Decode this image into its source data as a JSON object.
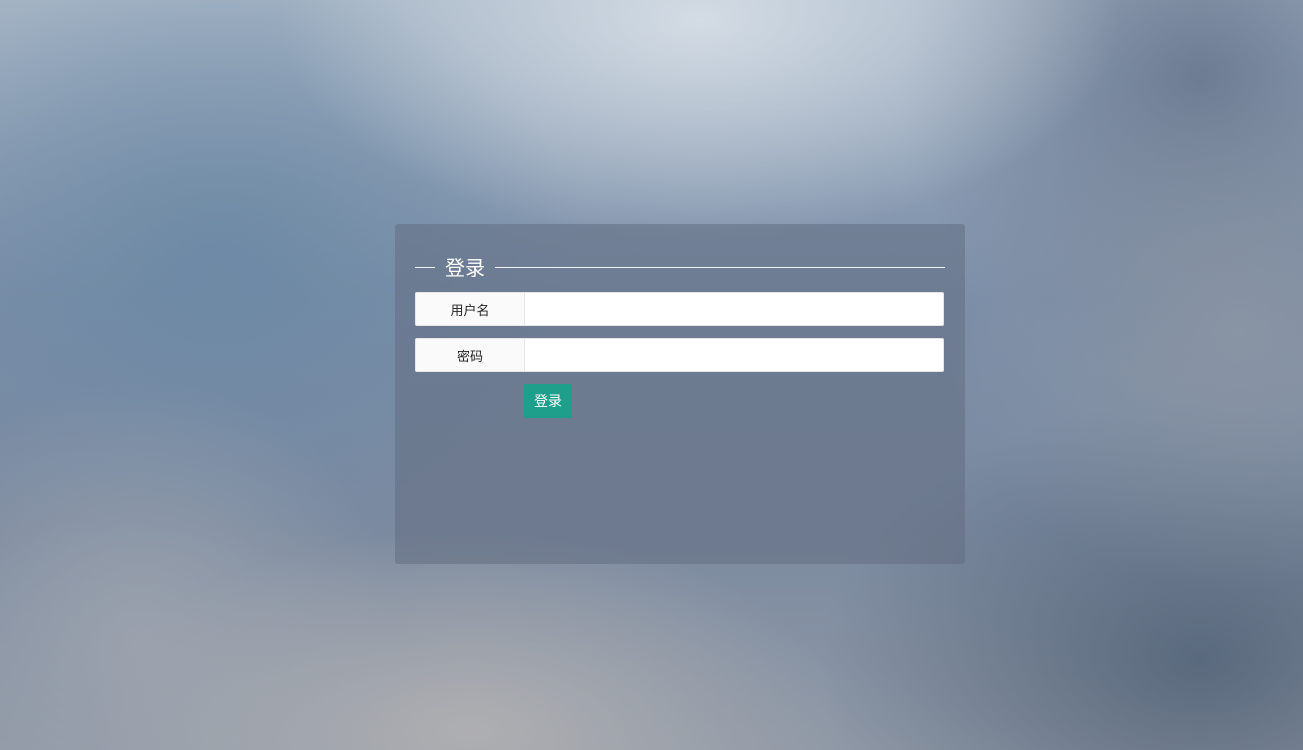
{
  "login": {
    "title": "登录",
    "username_label": "用户名",
    "username_value": "",
    "password_label": "密码",
    "password_value": "",
    "submit_label": "登录"
  },
  "colors": {
    "button": "#1e9f8b"
  }
}
